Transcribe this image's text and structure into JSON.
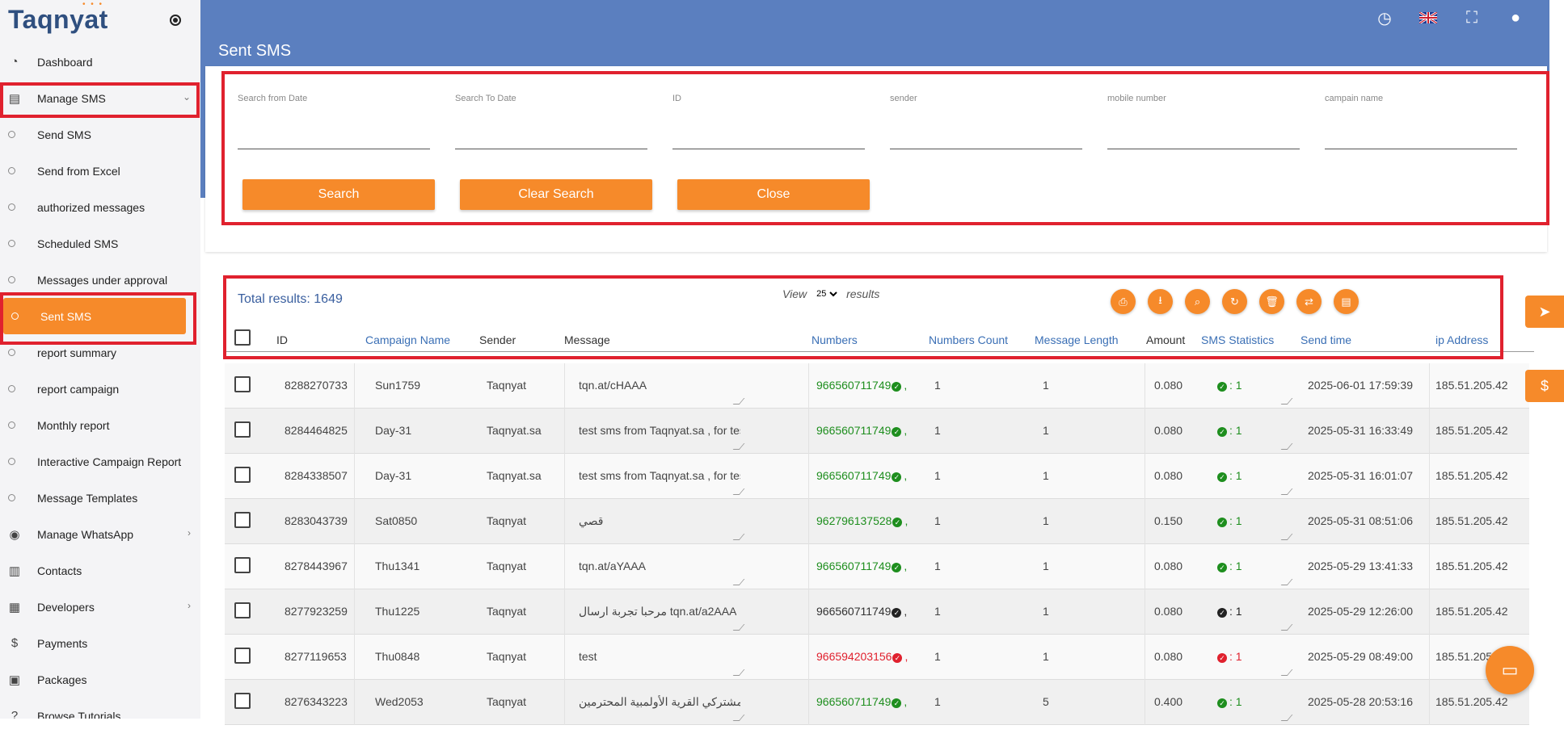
{
  "app": {
    "logo": "Taqnyat"
  },
  "sidebar": {
    "items": [
      {
        "label": "Dashboard",
        "icon": "dashboard-icon"
      },
      {
        "label": "Manage SMS",
        "icon": "sms-icon"
      },
      {
        "label": "Send SMS"
      },
      {
        "label": "Send from Excel"
      },
      {
        "label": "authorized messages"
      },
      {
        "label": "Scheduled SMS"
      },
      {
        "label": "Messages under approval"
      },
      {
        "label": "Sent SMS"
      },
      {
        "label": "report summary"
      },
      {
        "label": "report campaign"
      },
      {
        "label": "Monthly report"
      },
      {
        "label": "Interactive Campaign Report"
      },
      {
        "label": "Message Templates"
      },
      {
        "label": "Manage WhatsApp",
        "icon": "whatsapp-icon"
      },
      {
        "label": "Contacts",
        "icon": "contacts-icon"
      },
      {
        "label": "Developers",
        "icon": "developers-icon"
      },
      {
        "label": "Payments",
        "icon": "dollar-icon"
      },
      {
        "label": "Packages",
        "icon": "packages-icon"
      },
      {
        "label": "Browse Tutorials",
        "icon": "help-icon"
      }
    ]
  },
  "header": {
    "title": "Sent SMS"
  },
  "search": {
    "fields": [
      {
        "label": "Search from Date"
      },
      {
        "label": "Search To Date"
      },
      {
        "label": "ID"
      },
      {
        "label": "sender"
      },
      {
        "label": "mobile number"
      },
      {
        "label": "campain name"
      }
    ],
    "buttons": {
      "search": "Search",
      "clear": "Clear Search",
      "close": "Close"
    }
  },
  "results": {
    "total_label": "Total results:",
    "total": "1649",
    "view_label": "View",
    "view_value": "25",
    "view_suffix": "results"
  },
  "table": {
    "headers": {
      "id": "ID",
      "campaign": "Campaign Name",
      "sender": "Sender",
      "message": "Message",
      "numbers": "Numbers",
      "count": "Numbers Count",
      "length": "Message Length",
      "amount": "Amount",
      "stats": "SMS Statistics",
      "time": "Send time",
      "ip": "ip Address"
    },
    "rows": [
      {
        "id": "8288270733",
        "campaign": "Sun1759",
        "sender": "Taqnyat",
        "message": "tqn.at/cHAAA",
        "numbers": "966560711749",
        "status": "green",
        "count": "1",
        "length": "1",
        "amount": "0.080",
        "stats": ": 1",
        "time": "2025-06-01 17:59:39",
        "ip": "185.51.205.42"
      },
      {
        "id": "8284464825",
        "campaign": "Day-31",
        "sender": "Taqnyat.sa",
        "message": "test sms from Taqnyat.sa , for testing",
        "numbers": "966560711749",
        "status": "green",
        "count": "1",
        "length": "1",
        "amount": "0.080",
        "stats": ": 1",
        "time": "2025-05-31 16:33:49",
        "ip": "185.51.205.42"
      },
      {
        "id": "8284338507",
        "campaign": "Day-31",
        "sender": "Taqnyat.sa",
        "message": "test sms from Taqnyat.sa , for testing",
        "numbers": "966560711749",
        "status": "green",
        "count": "1",
        "length": "1",
        "amount": "0.080",
        "stats": ": 1",
        "time": "2025-05-31 16:01:07",
        "ip": "185.51.205.42"
      },
      {
        "id": "8283043739",
        "campaign": "Sat0850",
        "sender": "Taqnyat",
        "message": "قصي",
        "numbers": "962796137528",
        "status": "green",
        "count": "1",
        "length": "1",
        "amount": "0.150",
        "stats": ": 1",
        "time": "2025-05-31 08:51:06",
        "ip": "185.51.205.42"
      },
      {
        "id": "8278443967",
        "campaign": "Thu1341",
        "sender": "Taqnyat",
        "message": "tqn.at/aYAAA",
        "numbers": "966560711749",
        "status": "green",
        "count": "1",
        "length": "1",
        "amount": "0.080",
        "stats": ": 1",
        "time": "2025-05-29 13:41:33",
        "ip": "185.51.205.42"
      },
      {
        "id": "8277923259",
        "campaign": "Thu1225",
        "sender": "Taqnyat",
        "message": "مرحبا تجربة ارسال tqn.at/a2AAA",
        "numbers": "966560711749",
        "status": "black",
        "count": "1",
        "length": "1",
        "amount": "0.080",
        "stats": ": 1",
        "time": "2025-05-29 12:26:00",
        "ip": "185.51.205.42"
      },
      {
        "id": "8277119653",
        "campaign": "Thu0848",
        "sender": "Taqnyat",
        "message": "test",
        "numbers": "966594203156",
        "status": "red",
        "count": "1",
        "length": "1",
        "amount": "0.080",
        "stats": ": 1",
        "time": "2025-05-29 08:49:00",
        "ip": "185.51.205"
      },
      {
        "id": "8276343223",
        "campaign": "Wed2053",
        "sender": "Taqnyat",
        "message": "سادة مشتركي القرية الأولمبية المحترمين",
        "numbers": "966560711749",
        "status": "green",
        "count": "1",
        "length": "5",
        "amount": "0.400",
        "stats": ": 1",
        "time": "2025-05-28 20:53:16",
        "ip": "185.51.205.42"
      }
    ]
  },
  "colors": {
    "accent": "#f68a2a",
    "header": "#5b7fbf",
    "highlight": "#e0212e",
    "link": "#3a6fb5"
  }
}
